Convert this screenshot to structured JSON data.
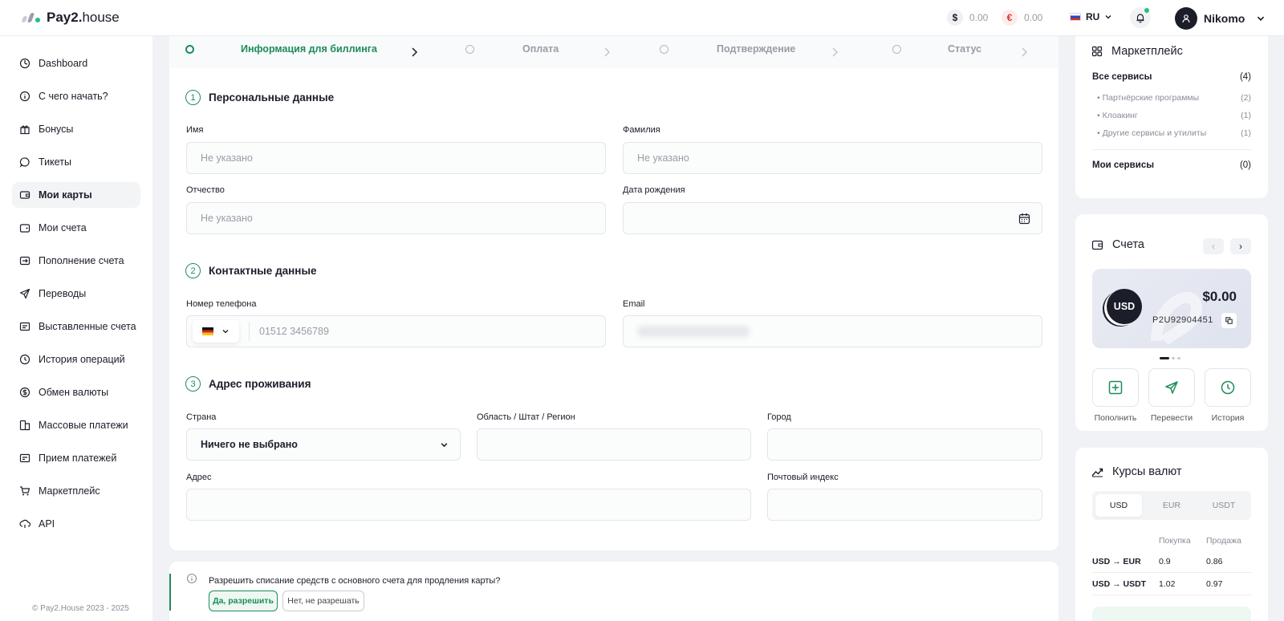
{
  "brand": {
    "name_bold": "Pay2.",
    "name_light": "house",
    "colors": {
      "accent": "#1d8c5a",
      "dark": "#1b1d29"
    }
  },
  "header": {
    "usd_symbol": "$",
    "usd_balance": "0.00",
    "eur_symbol": "€",
    "eur_balance": "0.00",
    "language": "RU",
    "user_name": "Nikomo"
  },
  "sidebar": {
    "items": [
      {
        "label": "Dashboard",
        "icon": "dashboard-icon"
      },
      {
        "label": "С чего начать?",
        "icon": "info-icon"
      },
      {
        "label": "Бонусы",
        "icon": "gift-icon"
      },
      {
        "label": "Тикеты",
        "icon": "chat-icon"
      },
      {
        "label": "Мои карты",
        "icon": "card-icon",
        "active": true
      },
      {
        "label": "Мои счета",
        "icon": "wallet-icon"
      },
      {
        "label": "Пополнение счета",
        "icon": "topup-icon"
      },
      {
        "label": "Переводы",
        "icon": "send-icon"
      },
      {
        "label": "Выставленные счета",
        "icon": "invoice-icon"
      },
      {
        "label": "История операций",
        "icon": "history-icon"
      },
      {
        "label": "Обмен валюты",
        "icon": "exchange-icon"
      },
      {
        "label": "Массовые платежи",
        "icon": "mass-pay-icon"
      },
      {
        "label": "Прием платежей",
        "icon": "receive-icon"
      },
      {
        "label": "Маркетплейс",
        "icon": "cart-icon"
      },
      {
        "label": "API",
        "icon": "api-icon"
      }
    ],
    "copyright": "© Pay2.House 2023 - 2025"
  },
  "stepper": {
    "steps": [
      {
        "label": "Информация для биллинга",
        "active": true
      },
      {
        "label": "Оплата"
      },
      {
        "label": "Подтверждение"
      },
      {
        "label": "Статус"
      }
    ]
  },
  "form": {
    "personal": {
      "number": "1",
      "title": "Персональные данные",
      "first_name_label": "Имя",
      "first_name_placeholder": "Не указано",
      "last_name_label": "Фамилия",
      "last_name_placeholder": "Не указано",
      "patronymic_label": "Отчество",
      "patronymic_placeholder": "Не указано",
      "birth_label": "Дата рождения"
    },
    "contacts": {
      "number": "2",
      "title": "Контактные данные",
      "phone_label": "Номер телефона",
      "phone_placeholder": "01512 3456789",
      "email_label": "Email"
    },
    "address": {
      "number": "3",
      "title": "Адрес проживания",
      "country_label": "Страна",
      "country_value": "Ничего не выбрано",
      "region_label": "Область / Штат / Регион",
      "city_label": "Город",
      "address_label": "Адрес",
      "zip_label": "Почтовый индекс"
    }
  },
  "notice": {
    "text": "Разрешить списание средств с основного счета для продления карты?",
    "yes": "Да, разрешить",
    "no": "Нет, не разрешать"
  },
  "marketplace": {
    "title": "Маркетплейс",
    "all": {
      "label": "Все сервисы",
      "count": "(4)"
    },
    "items": [
      {
        "label": "Партнёрские программы",
        "count": "(2)"
      },
      {
        "label": "Клоакинг",
        "count": "(1)"
      },
      {
        "label": "Другие сервисы и утилиты",
        "count": "(1)"
      }
    ],
    "mine": {
      "label": "Мои сервисы",
      "count": "(0)"
    }
  },
  "accounts": {
    "title": "Счета",
    "currency": "USD",
    "amount": "$0.00",
    "account_id": "P2U92904451",
    "actions": [
      "Пополнить",
      "Перевести",
      "История"
    ]
  },
  "rates": {
    "title": "Курсы валют",
    "tabs": [
      "USD",
      "EUR",
      "USDT"
    ],
    "active_tab": "USD",
    "buy_label": "Покупка",
    "sell_label": "Продажа",
    "rows": [
      {
        "pair": "USD → EUR",
        "buy": "0.9",
        "sell": "0.86"
      },
      {
        "pair": "USD → USDT",
        "buy": "1.02",
        "sell": "0.97"
      }
    ]
  }
}
